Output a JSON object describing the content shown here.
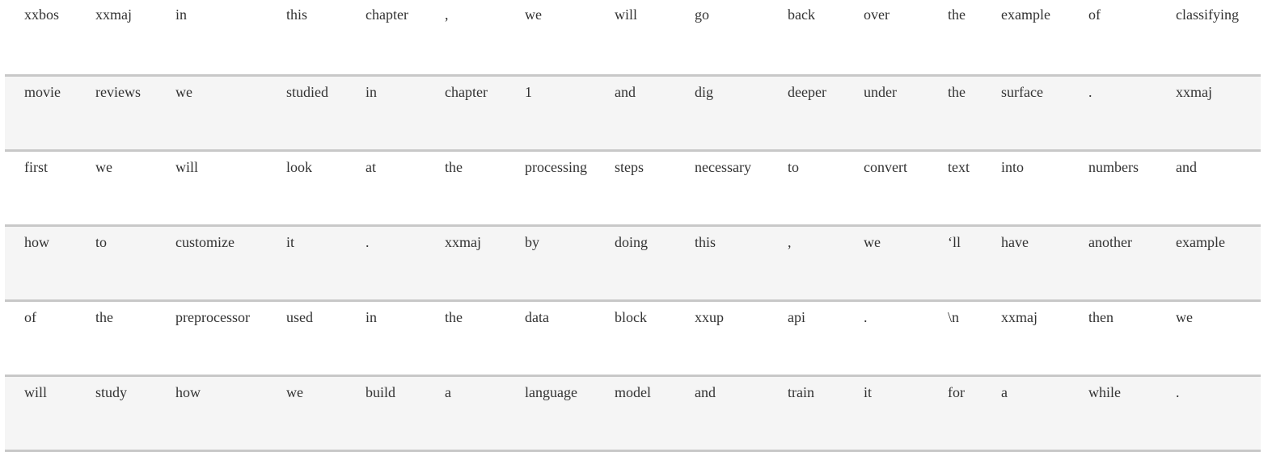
{
  "table": {
    "rows": [
      [
        "xxbos",
        "xxmaj",
        "in",
        "this",
        "chapter",
        ",",
        "we",
        "will",
        "go",
        "back",
        "over",
        "the",
        "example",
        "of",
        "classifying"
      ],
      [
        "movie",
        "reviews",
        "we",
        "studied",
        "in",
        "chapter",
        "1",
        "and",
        "dig",
        "deeper",
        "under",
        "the",
        "surface",
        ".",
        "xxmaj"
      ],
      [
        "first",
        "we",
        "will",
        "look",
        "at",
        "the",
        "processing",
        "steps",
        "necessary",
        "to",
        "convert",
        "text",
        "into",
        "numbers",
        "and"
      ],
      [
        "how",
        "to",
        "customize",
        "it",
        ".",
        "xxmaj",
        "by",
        "doing",
        "this",
        ",",
        "we",
        "‘ll",
        "have",
        "another",
        "example"
      ],
      [
        "of",
        "the",
        "preprocessor",
        "used",
        "in",
        "the",
        "data",
        "block",
        "xxup",
        "api",
        ".",
        "\\n",
        "xxmaj",
        "then",
        "we"
      ],
      [
        "will",
        "study",
        "how",
        "we",
        "build",
        "a",
        "language",
        "model",
        "and",
        "train",
        "it",
        "for",
        "a",
        "while",
        "."
      ]
    ]
  }
}
